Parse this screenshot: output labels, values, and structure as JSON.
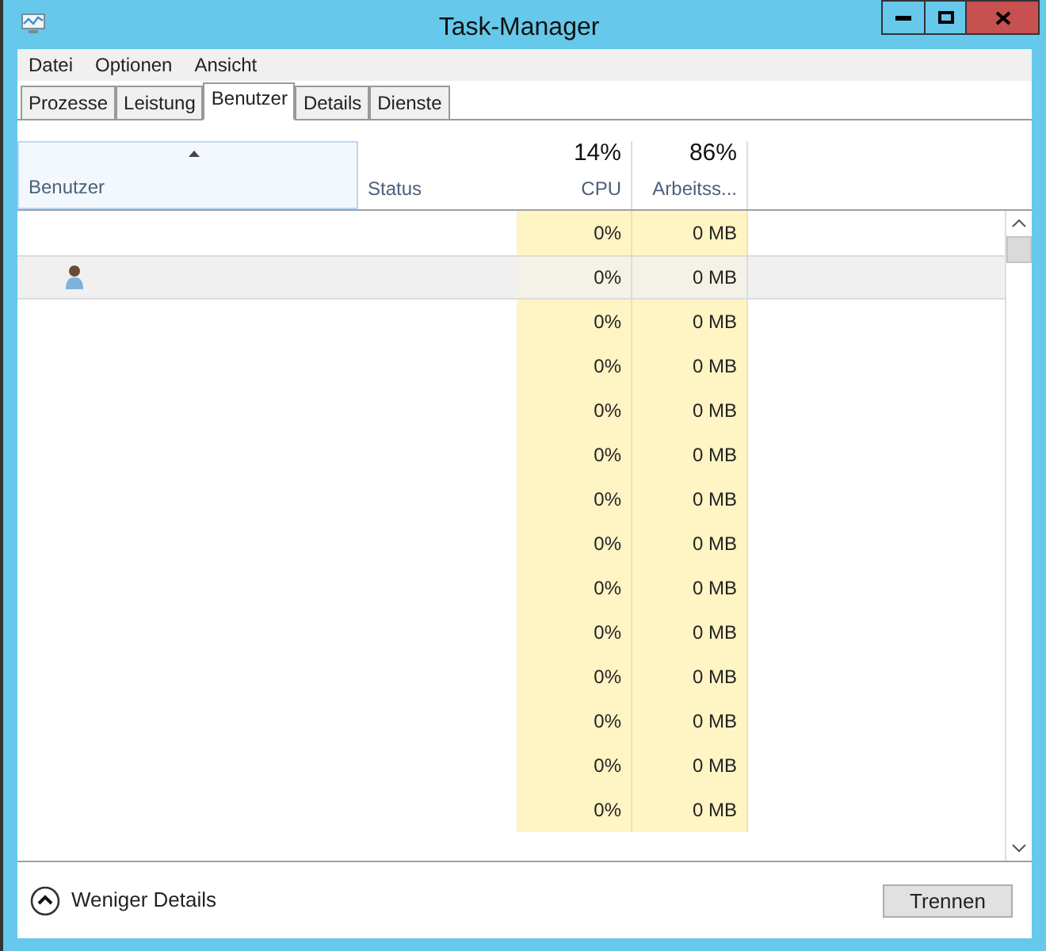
{
  "window": {
    "title": "Task-Manager"
  },
  "menu": [
    "Datei",
    "Optionen",
    "Ansicht"
  ],
  "tabs": [
    {
      "label": "Prozesse",
      "selected": false
    },
    {
      "label": "Leistung",
      "selected": false
    },
    {
      "label": "Benutzer",
      "selected": true
    },
    {
      "label": "Details",
      "selected": false
    },
    {
      "label": "Dienste",
      "selected": false
    }
  ],
  "table": {
    "columns": [
      {
        "label": "Benutzer",
        "sorted": true
      },
      {
        "label": "Status",
        "sorted": false
      },
      {
        "label": "CPU",
        "total": "14%",
        "sorted": false
      },
      {
        "label": "Arbeitss...",
        "total": "86%",
        "sorted": false
      }
    ],
    "rows": [
      {
        "kind": "blank",
        "selected": false,
        "cpu": "0%",
        "memory": "0 MB"
      },
      {
        "kind": "user",
        "selected": true,
        "cpu": "0%",
        "memory": "0 MB"
      },
      {
        "kind": "blank",
        "selected": false,
        "cpu": "0%",
        "memory": "0 MB"
      },
      {
        "kind": "blank",
        "selected": false,
        "cpu": "0%",
        "memory": "0 MB"
      },
      {
        "kind": "blank",
        "selected": false,
        "cpu": "0%",
        "memory": "0 MB"
      },
      {
        "kind": "blank",
        "selected": false,
        "cpu": "0%",
        "memory": "0 MB"
      },
      {
        "kind": "blank",
        "selected": false,
        "cpu": "0%",
        "memory": "0 MB"
      },
      {
        "kind": "blank",
        "selected": false,
        "cpu": "0%",
        "memory": "0 MB"
      },
      {
        "kind": "blank",
        "selected": false,
        "cpu": "0%",
        "memory": "0 MB"
      },
      {
        "kind": "blank",
        "selected": false,
        "cpu": "0%",
        "memory": "0 MB"
      },
      {
        "kind": "blank",
        "selected": false,
        "cpu": "0%",
        "memory": "0 MB"
      },
      {
        "kind": "blank",
        "selected": false,
        "cpu": "0%",
        "memory": "0 MB"
      },
      {
        "kind": "blank",
        "selected": false,
        "cpu": "0%",
        "memory": "0 MB"
      },
      {
        "kind": "blank",
        "selected": false,
        "cpu": "0%",
        "memory": "0 MB"
      }
    ]
  },
  "footer": {
    "toggle": "Weniger Details",
    "button": "Trennen"
  }
}
